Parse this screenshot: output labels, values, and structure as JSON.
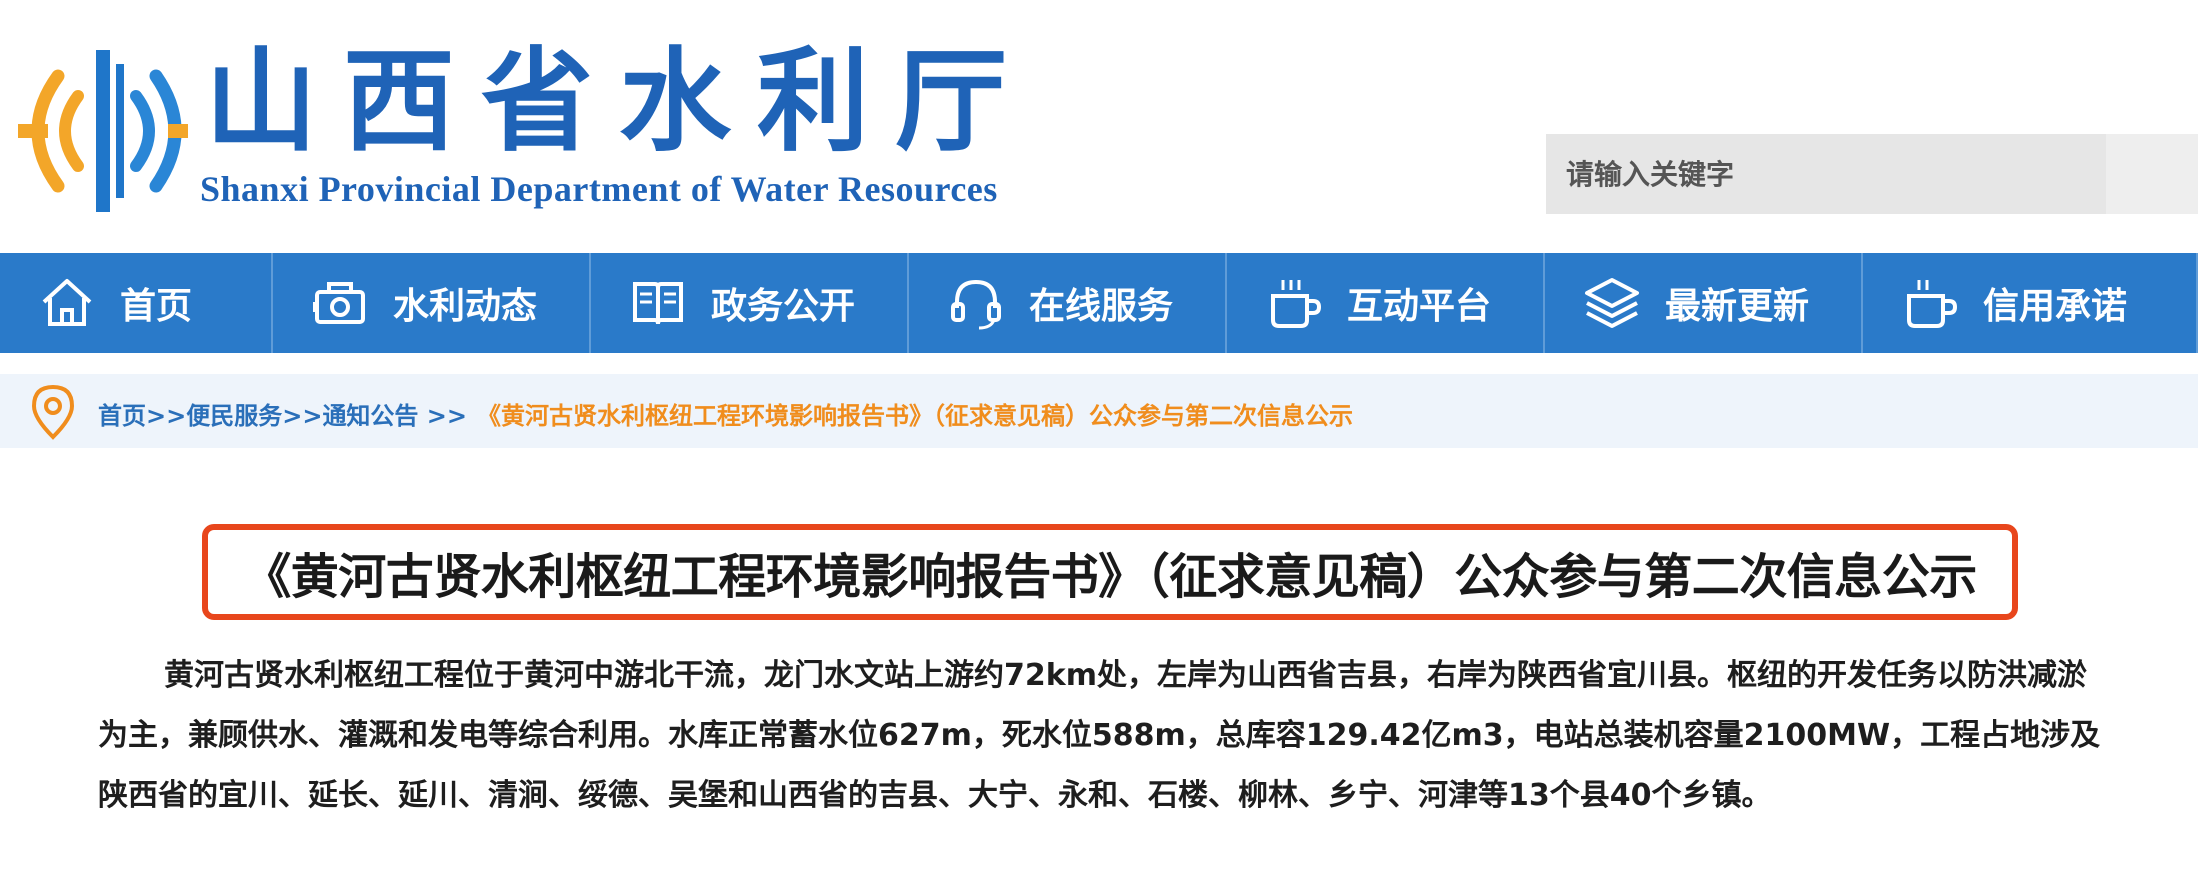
{
  "header": {
    "logo_cn": "山西省水利厅",
    "logo_en": "Shanxi Provincial Department of Water Resources",
    "search_placeholder": "请输入关键字"
  },
  "nav": {
    "items": [
      {
        "label": "首页",
        "icon": "home-icon"
      },
      {
        "label": "水利动态",
        "icon": "camera-icon"
      },
      {
        "label": "政务公开",
        "icon": "book-icon"
      },
      {
        "label": "在线服务",
        "icon": "headset-icon"
      },
      {
        "label": "互动平台",
        "icon": "cup-icon"
      },
      {
        "label": "最新更新",
        "icon": "layers-icon"
      },
      {
        "label": "信用承诺",
        "icon": "cup-icon"
      }
    ]
  },
  "breadcrumb": {
    "home": "首页",
    "sep": ">>",
    "service": "便民服务",
    "notice": "通知公告",
    "sep2": ">>",
    "current": "《黄河古贤水利枢纽工程环境影响报告书》（征求意见稿）公众参与第二次信息公示"
  },
  "article": {
    "title": "《黄河古贤水利枢纽工程环境影响报告书》（征求意见稿）公众参与第二次信息公示",
    "paragraph": "黄河古贤水利枢纽工程位于黄河中游北干流，龙门水文站上游约72km处，左岸为山西省吉县，右岸为陕西省宜川县。枢纽的开发任务以防洪减淤为主，兼顾供水、灌溉和发电等综合利用。水库正常蓄水位627m，死水位588m，总库容129.42亿m3，电站总装机容量2100MW，工程占地涉及陕西省的宜川、延长、延川、清涧、绥德、吴堡和山西省的吉县、大宁、永和、石楼、柳林、乡宁、河津等13个县40个乡镇。"
  },
  "colors": {
    "brand_blue": "#1f63b7",
    "nav_blue": "#2a7ac9",
    "logo_orange": "#f3a629",
    "highlight_red": "#e8461c",
    "crumb_orange": "#f08d1d"
  }
}
